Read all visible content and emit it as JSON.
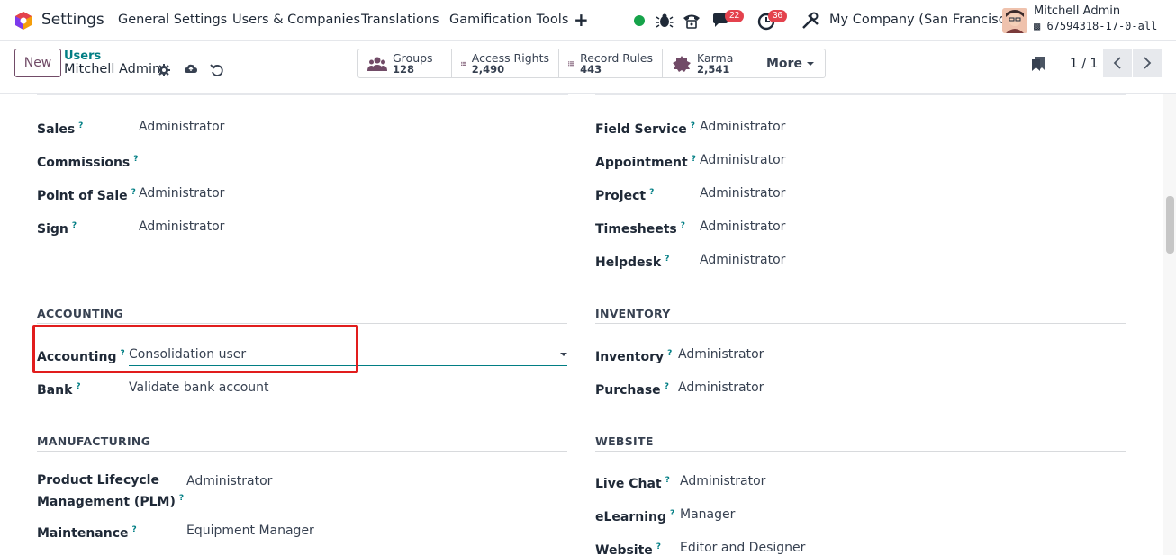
{
  "topnav": {
    "app_title": "Settings",
    "menus": [
      "General Settings",
      "Users & Companies",
      "Translations",
      "Gamification Tools"
    ],
    "plus_label": "+",
    "chat_badge": "22",
    "activity_badge": "36",
    "company": "My Company (San Francisco)",
    "user_name": "Mitchell Admin",
    "user_db": "67594318-17-0-all"
  },
  "control_panel": {
    "new_label": "New",
    "breadcrumb_parent": "Users",
    "breadcrumb_current": "Mitchell Admin",
    "stats": [
      {
        "label": "Groups",
        "value": "128",
        "icon": "users-icon"
      },
      {
        "label": "Access Rights",
        "value": "2,490",
        "icon": "list-icon"
      },
      {
        "label": "Record Rules",
        "value": "443",
        "icon": "list-icon"
      },
      {
        "label": "Karma",
        "value": "2,541",
        "icon": "badge-icon"
      }
    ],
    "more_label": "More",
    "pager": "1 / 1"
  },
  "form": {
    "left_top": [
      {
        "label": "Sales",
        "value": "Administrator"
      },
      {
        "label": "Commissions",
        "value": ""
      },
      {
        "label": "Point of Sale",
        "value": "Administrator"
      },
      {
        "label": "Sign",
        "value": "Administrator"
      }
    ],
    "right_top": [
      {
        "label": "Field Service",
        "value": "Administrator"
      },
      {
        "label": "Appointment",
        "value": "Administrator"
      },
      {
        "label": "Project",
        "value": "Administrator"
      },
      {
        "label": "Timesheets",
        "value": "Administrator"
      },
      {
        "label": "Helpdesk",
        "value": "Administrator"
      }
    ],
    "accounting": {
      "title": "ACCOUNTING",
      "fields": [
        {
          "label": "Accounting",
          "value": "Consolidation user"
        },
        {
          "label": "Bank",
          "value": "Validate bank account"
        }
      ]
    },
    "inventory": {
      "title": "INVENTORY",
      "fields": [
        {
          "label": "Inventory",
          "value": "Administrator"
        },
        {
          "label": "Purchase",
          "value": "Administrator"
        }
      ]
    },
    "manufacturing": {
      "title": "MANUFACTURING",
      "fields": [
        {
          "label_line1": "Product Lifecycle",
          "label_line2": "Management (PLM)",
          "value": "Administrator"
        },
        {
          "label": "Maintenance",
          "value": "Equipment Manager"
        }
      ]
    },
    "website": {
      "title": "WEBSITE",
      "fields": [
        {
          "label": "Live Chat",
          "value": "Administrator"
        },
        {
          "label": "eLearning",
          "value": "Manager"
        },
        {
          "label": "Website",
          "value": "Editor and Designer"
        }
      ]
    },
    "help_mark": "?"
  },
  "colors": {
    "brand": "#714b67",
    "accent": "#017e84",
    "highlight": "#e11d1d",
    "badge": "#e4424d"
  }
}
